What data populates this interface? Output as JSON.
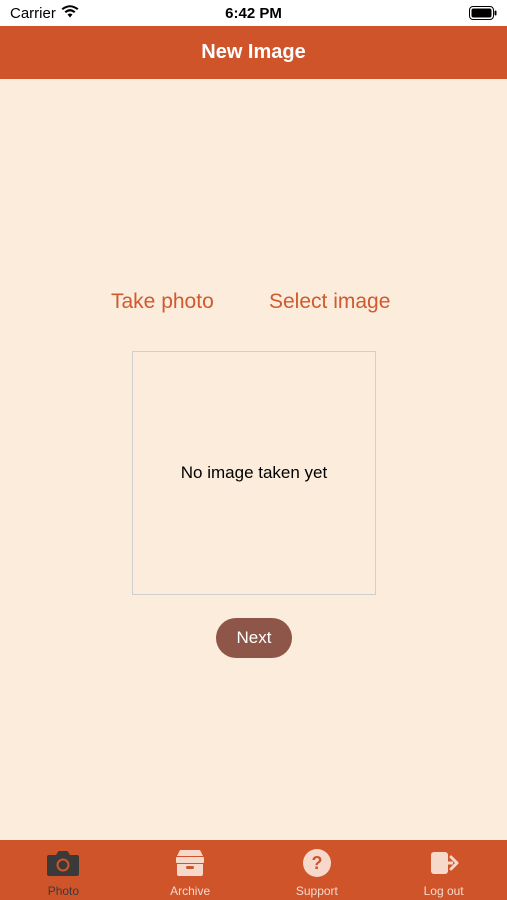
{
  "status_bar": {
    "carrier": "Carrier",
    "time": "6:42 PM"
  },
  "nav": {
    "title": "New Image"
  },
  "actions": {
    "take_photo": "Take photo",
    "select_image": "Select image"
  },
  "image_box": {
    "placeholder": "No image taken yet"
  },
  "next_button": "Next",
  "tabs": [
    {
      "label": "Photo",
      "icon": "camera-icon",
      "active": true
    },
    {
      "label": "Archive",
      "icon": "archive-icon",
      "active": false
    },
    {
      "label": "Support",
      "icon": "question-icon",
      "active": false
    },
    {
      "label": "Log out",
      "icon": "logout-icon",
      "active": false
    }
  ],
  "colors": {
    "accent": "#d0542a",
    "background": "#fcecdc",
    "next_button": "#8e5648",
    "active_tab": "#3a3a3a"
  }
}
